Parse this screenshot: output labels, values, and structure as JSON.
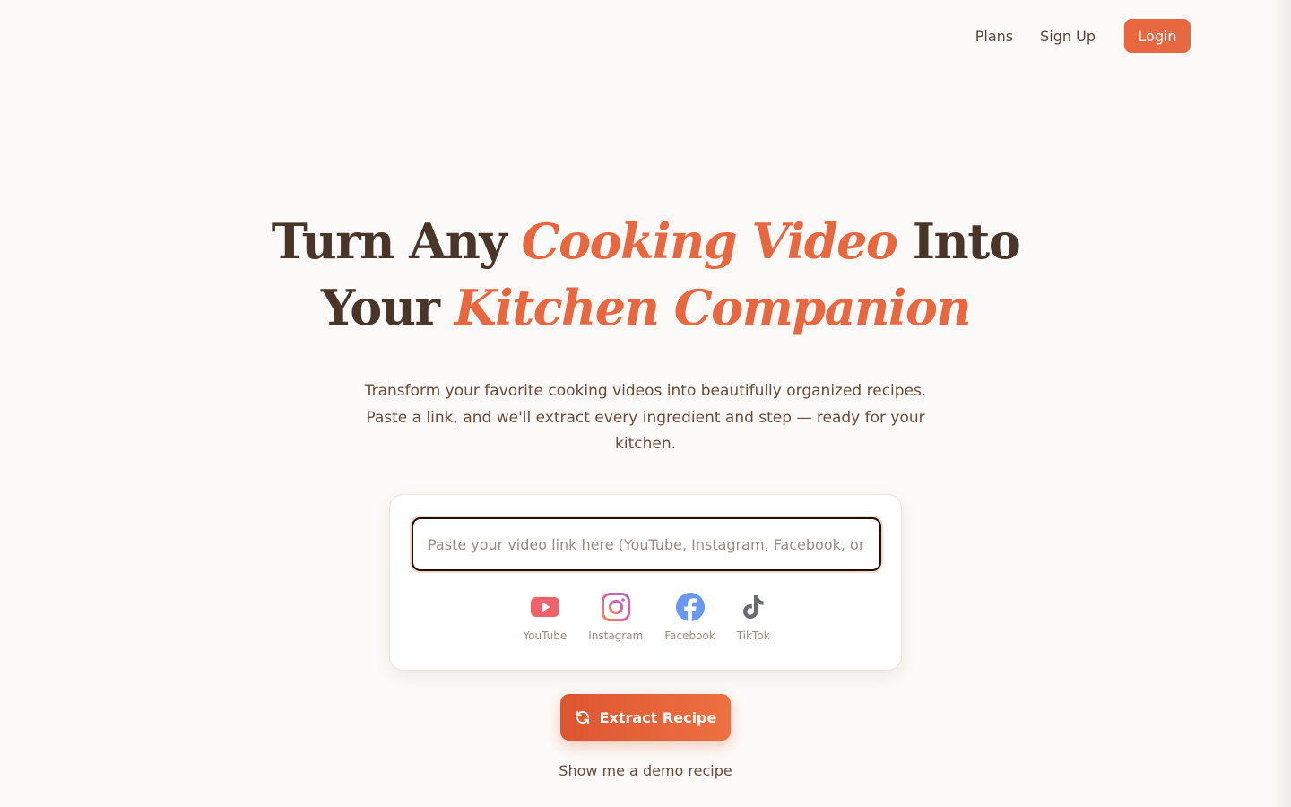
{
  "nav": {
    "links": [
      "Plans",
      "Sign Up"
    ],
    "login_label": "Login"
  },
  "hero": {
    "title_part1": "Turn Any ",
    "title_accent1": "Cooking Video",
    "title_part2": " Into",
    "title_part3": "Your ",
    "title_accent2": "Kitchen Companion",
    "subtitle": "Transform your favorite cooking videos into beautifully organized recipes. Paste a link, and we'll extract every ingredient and step — ready for your kitchen."
  },
  "input": {
    "placeholder": "Paste your video link here (YouTube, Instagram, Facebook, or TikTok)",
    "value": ""
  },
  "platforms": [
    {
      "label": "YouTube",
      "icon": "youtube-icon",
      "color": "#f0626a"
    },
    {
      "label": "Instagram",
      "icon": "instagram-icon",
      "color": "#e05ea8"
    },
    {
      "label": "Facebook",
      "icon": "facebook-icon",
      "color": "#6a98ee"
    },
    {
      "label": "TikTok",
      "icon": "tiktok-icon",
      "color": "#6b6b72"
    }
  ],
  "cta": {
    "extract_label": "Extract Recipe",
    "demo_label": "Show me a demo recipe"
  },
  "colors": {
    "accent": "#e9673f",
    "heading": "#4a3529",
    "body_text": "#6b4b38",
    "background": "#fcfaf8"
  }
}
